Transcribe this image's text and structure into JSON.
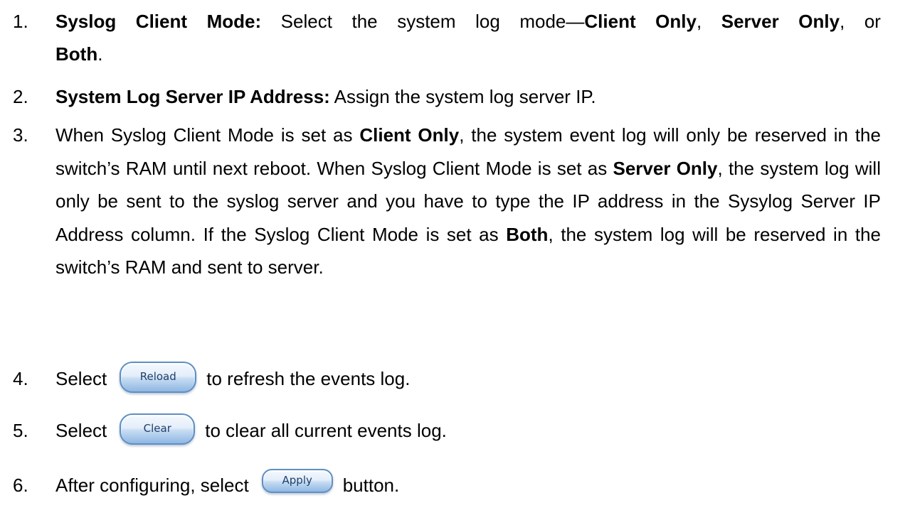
{
  "items": [
    {
      "number": "1.",
      "title": "Syslog Client Mode:",
      "text_a": " Select the system log mode—",
      "opt_client": "Client Only",
      "sep_1": ", ",
      "opt_server": "Server Only",
      "sep_2": ", or",
      "opt_both": "Both",
      "end": "."
    },
    {
      "number": "2.",
      "title": "System Log Server IP Address:",
      "text": " Assign the system log server IP."
    },
    {
      "number": "3.",
      "t1": "When Syslog Client Mode is set as ",
      "b1": "Client Only",
      "t2": ", the system event log will only be reserved in the switch’s RAM until next reboot. When Syslog Client Mode is set as ",
      "b2": "Server Only",
      "t3": ", the system log will only be sent to the syslog server and you have to type the IP address in the Sysylog Server IP Address column. If the Syslog Client Mode is set as ",
      "b3": "Both",
      "t4": ", the system log will be reserved in the switch’s RAM and sent to server."
    },
    {
      "number": "4.",
      "pre": "Select",
      "button": "Reload",
      "post": "to refresh the events log."
    },
    {
      "number": "5.",
      "pre": "Select",
      "button": "Clear",
      "post": "to clear all current events log."
    },
    {
      "number": "6.",
      "pre": "After configuring, select",
      "button": "Apply",
      "post": "button."
    }
  ]
}
